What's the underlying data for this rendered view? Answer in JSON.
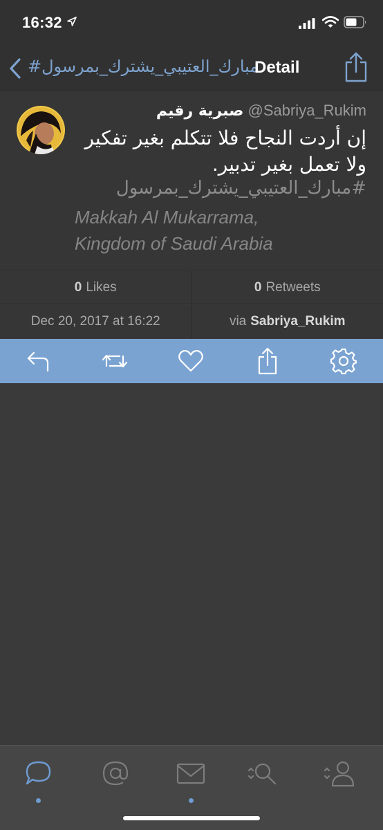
{
  "status_bar": {
    "time": "16:32",
    "icons": [
      "location-arrow-icon",
      "cellular-signal-icon",
      "wifi-icon",
      "battery-icon"
    ]
  },
  "nav": {
    "back_label": "#مبارك_العتيبي_يشترك_بمرسول",
    "title": "Detail",
    "share_icon": "share-icon"
  },
  "tweet": {
    "display_name": "صبرية رقيم",
    "handle": "@Sabriya_Rukim",
    "text": "إن أردت النجاح فلا تتكلم بغير تفكير ولا تعمل بغير تدبير.",
    "hashtag": "#مبارك_العتيبي_يشترك_بمرسول",
    "location_line1": "Makkah Al Mukarrama,",
    "location_line2": "Kingdom of Saudi Arabia"
  },
  "stats": {
    "likes_count": "0",
    "likes_label": "Likes",
    "retweets_count": "0",
    "retweets_label": "Retweets"
  },
  "meta": {
    "date": "Dec 20, 2017 at 16:22",
    "via_label": "via",
    "via_name": "Sabriya_Rukim"
  },
  "actions": [
    "reply-icon",
    "retweet-icon",
    "like-heart-icon",
    "share-icon",
    "settings-gear-icon"
  ],
  "tabs": [
    {
      "icon": "chat-bubble-icon",
      "active": true
    },
    {
      "icon": "mentions-at-icon",
      "active": false
    },
    {
      "icon": "messages-envelope-icon",
      "active": false
    },
    {
      "icon": "search-magnifier-icon",
      "active": false
    },
    {
      "icon": "profile-person-icon",
      "active": false
    }
  ],
  "colors": {
    "accent": "#7ea3cf",
    "action_bar": "#7aa3d2",
    "background": "#3a3a3a",
    "tab_bar": "#464646"
  }
}
